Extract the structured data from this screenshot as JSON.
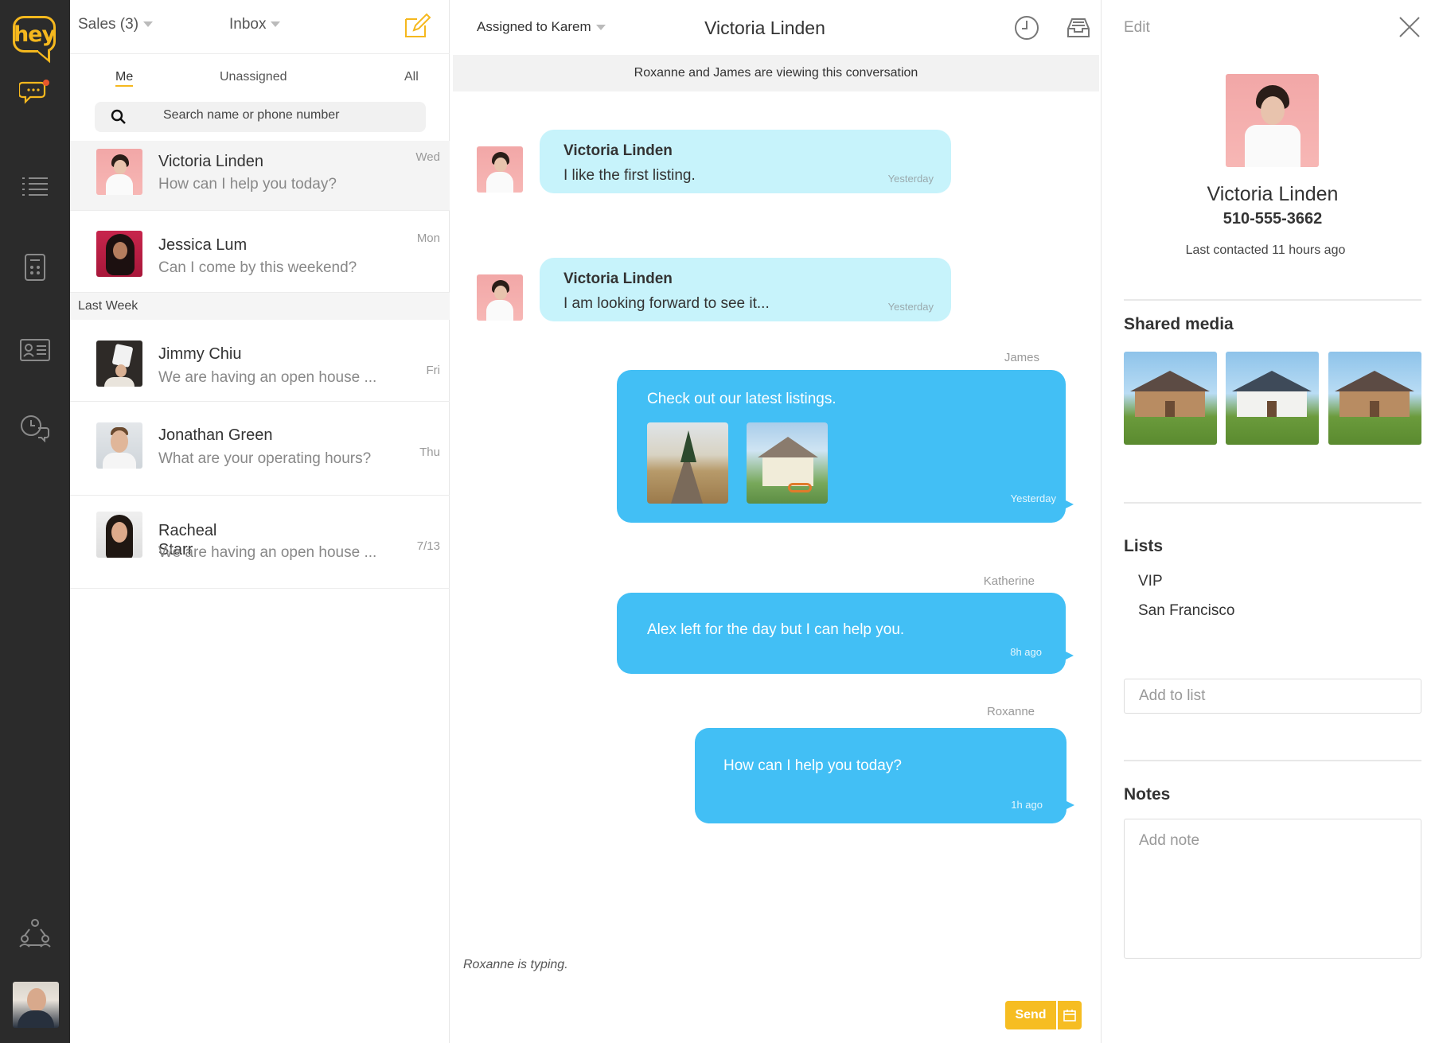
{
  "app": {
    "logo_text": "hey",
    "accent_color": "#f5b81e",
    "bubble_color": "#42bff5",
    "rail_icons": [
      "conversations-icon",
      "list-icon",
      "dialer-icon",
      "contact-card-icon",
      "scheduled-messages-icon",
      "team-icon"
    ]
  },
  "list_header": {
    "sales_label": "Sales (3)",
    "inbox_label": "Inbox"
  },
  "filters": {
    "me": "Me",
    "unassigned": "Unassigned",
    "all": "All"
  },
  "search": {
    "placeholder": "Search name or phone number"
  },
  "conversations": [
    {
      "name": "Victoria Linden",
      "preview": "How can I help you today?",
      "time": "Wed"
    },
    {
      "name": "Jessica Lum",
      "preview": "Can I come by this weekend?",
      "time": "Mon"
    },
    {
      "name": "Jimmy Chiu",
      "preview": "We are having an open house ...",
      "time": "Fri"
    },
    {
      "name": "Jonathan Green",
      "preview": "What are your operating hours?",
      "time": "Thu"
    },
    {
      "name": "Racheal Starr",
      "preview": "We are having an open house ...",
      "time": "7/13"
    }
  ],
  "section_last_week": "Last Week",
  "chat": {
    "assigned_label": "Assigned to Karem",
    "title": "Victoria Linden",
    "viewing_notice": "Roxanne and James are viewing this conversation",
    "messages": [
      {
        "sender": "Victoria Linden",
        "text": "I like the first listing.",
        "time": "Yesterday"
      },
      {
        "sender": "Victoria Linden",
        "text": "I am looking forward to see it...",
        "time": "Yesterday"
      },
      {
        "author": "James",
        "text": "Check out our latest listings.",
        "time": "Yesterday"
      },
      {
        "author": "Katherine",
        "text": "Alex left for the day but I can help you.",
        "time": "8h ago"
      },
      {
        "author": "Roxanne",
        "text": "How can I help you today?",
        "time": "1h ago"
      }
    ],
    "typing_indicator": "Roxanne is typing.",
    "send_label": "Send"
  },
  "contact": {
    "edit_label": "Edit",
    "name": "Victoria Linden",
    "phone": "510-555-3662",
    "last_contacted": "Last contacted 11 hours ago",
    "shared_media_title": "Shared media",
    "lists_title": "Lists",
    "lists": [
      "VIP",
      "San Francisco"
    ],
    "add_to_list_placeholder": "Add to list",
    "notes_title": "Notes",
    "add_note_placeholder": "Add note"
  }
}
